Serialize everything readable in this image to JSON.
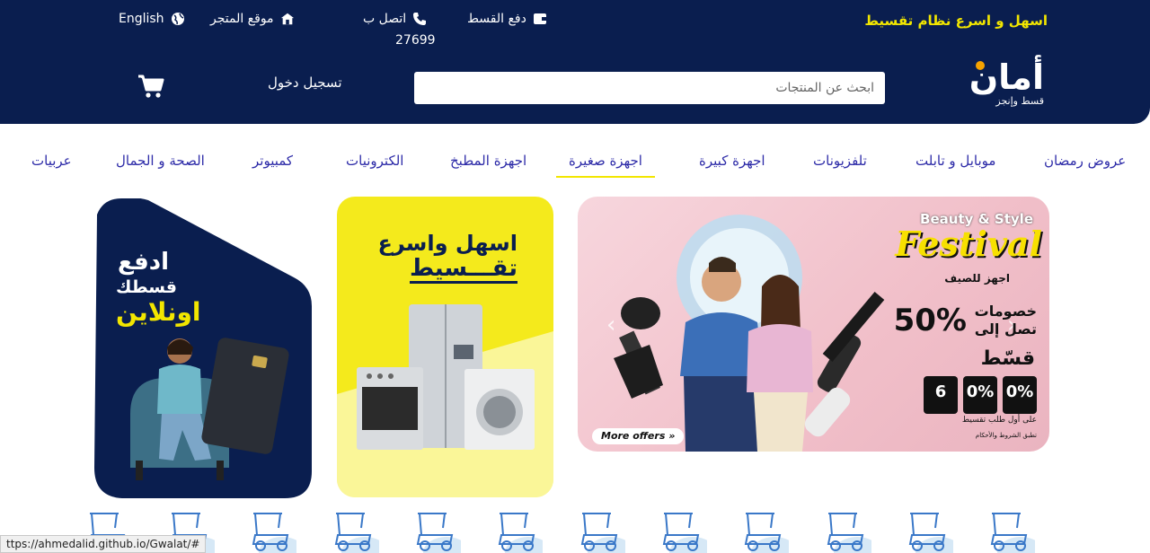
{
  "header": {
    "tagline": "اسهل و اسرع نظام تقسيط",
    "links": {
      "pay": "دفع القسط",
      "call": "اتصل ب",
      "call_number": "27699",
      "store": "موقع المتجر",
      "language": "English"
    },
    "logo": {
      "name": "أمان",
      "subtitle": "قسط وإنجز"
    },
    "search": {
      "placeholder": "ابحث عن المنتجات"
    },
    "login": "تسجيل دخول"
  },
  "nav": {
    "items": [
      {
        "label": "عروض رمضان"
      },
      {
        "label": "موبايل و تابلت"
      },
      {
        "label": "تلفزيونات"
      },
      {
        "label": "اجهزة كبيرة"
      },
      {
        "label": "اجهزة صغيرة",
        "active": true
      },
      {
        "label": "اجهزة المطبخ"
      },
      {
        "label": "الكترونيات"
      },
      {
        "label": "كمبيوتر"
      },
      {
        "label": "الصحة و الجمال"
      },
      {
        "label": "عربيات"
      }
    ]
  },
  "banners": {
    "main": {
      "top": "Beauty & Style",
      "title": "Festival",
      "subtitle": "اجهز للصيف",
      "discount_line1": "خصومات",
      "discount_line2": "تصل إلى",
      "discount_value": "50%",
      "installment": "قسّط",
      "boxes": [
        {
          "value": "0%",
          "caption": "فوائد"
        },
        {
          "value": "0%",
          "caption": "مقدم"
        },
        {
          "value": "6",
          "caption": "شهور"
        }
      ],
      "boxes_note": "على أول طلب تقسيط",
      "terms": "تطبق الشروط والأحكام",
      "more": "More offers »"
    },
    "middle": {
      "line1": "اسهل واسرع",
      "line2": "تقـــسيط"
    },
    "left": {
      "line1": "ادفع",
      "line2": "قسطك",
      "line3": "اونلاين"
    }
  },
  "status_url": "ttps://ahmedalid.github.io/Gwalat/#",
  "colors": {
    "header_bg": "#0a1e4f",
    "accent_yellow": "#f2e600",
    "nav_text": "#2d2ba8"
  }
}
